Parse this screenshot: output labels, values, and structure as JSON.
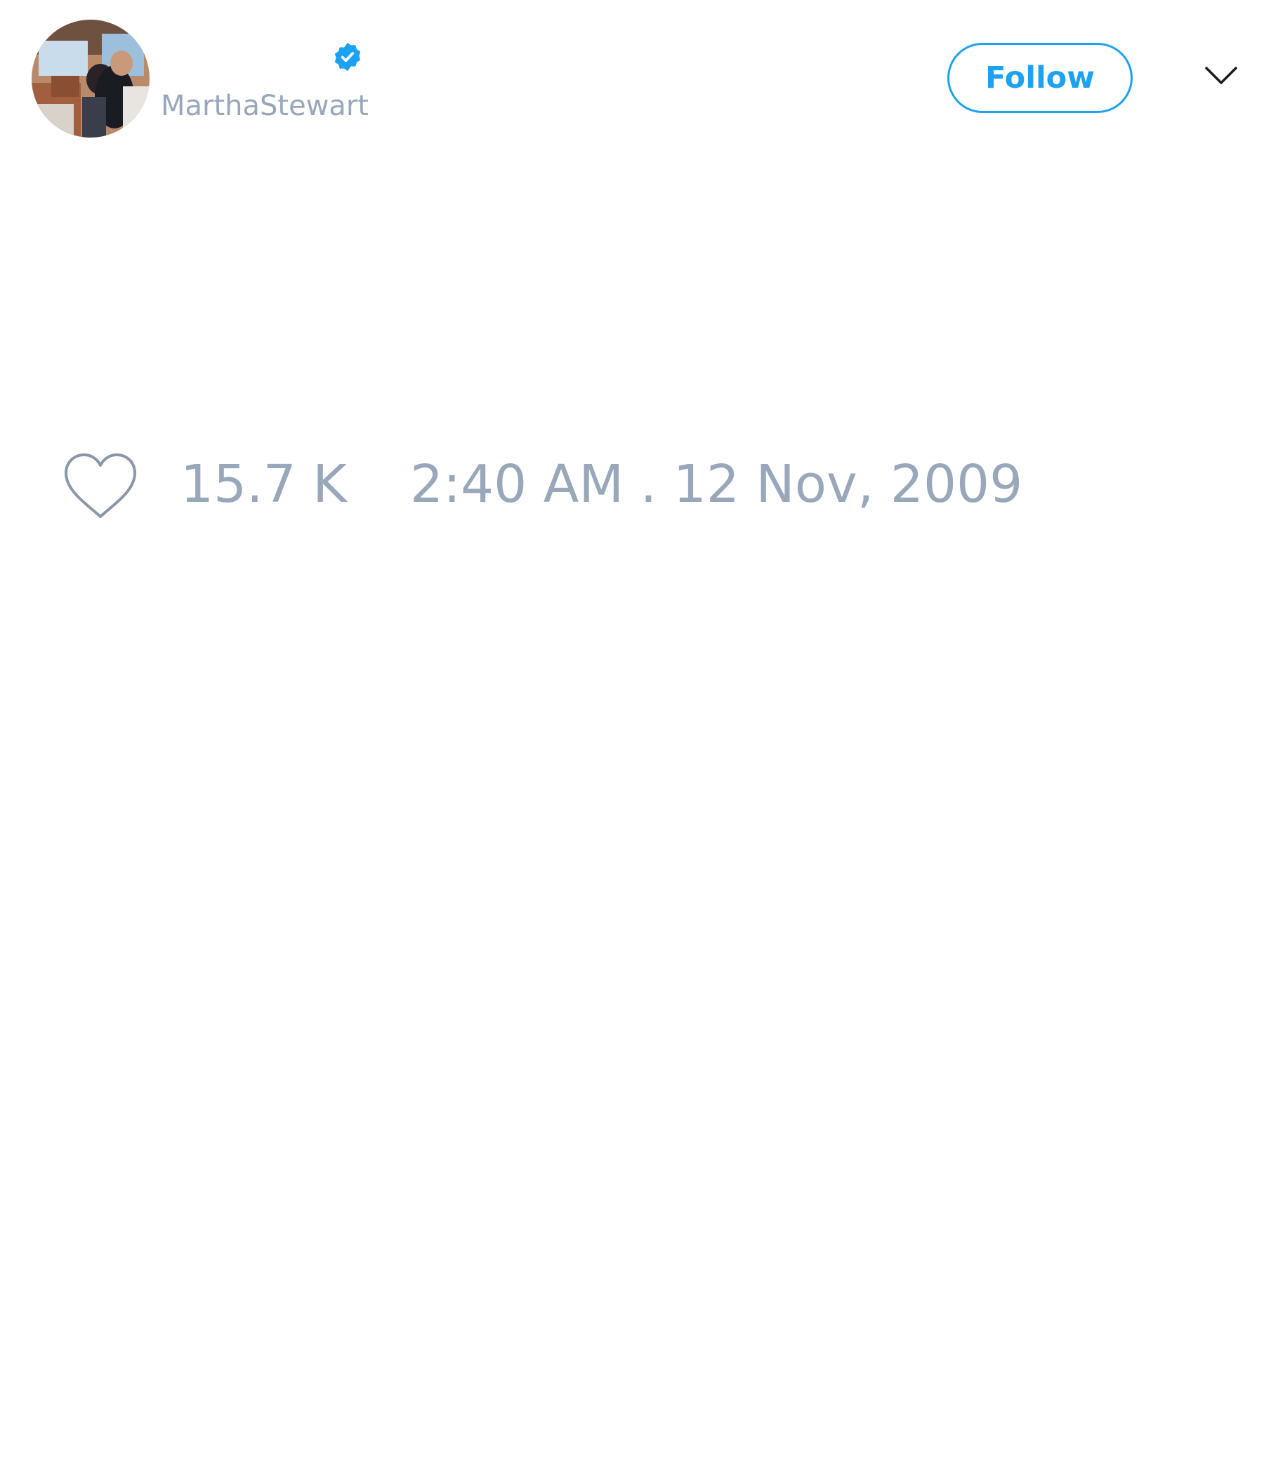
{
  "user": {
    "handle": "MarthaStewart",
    "avatar_icon": "profile-photo",
    "verified_icon": "verified-badge-icon"
  },
  "actions": {
    "follow_label": "Follow",
    "menu_icon": "chevron-down-icon"
  },
  "stats": {
    "like_icon": "heart-outline-icon",
    "likes": "15.7 K",
    "timestamp": "2:40 AM . 12 Nov, 2009"
  },
  "colors": {
    "accent": "#1da1f2",
    "muted_text": "#99a7bb",
    "background": "#ffffff"
  }
}
